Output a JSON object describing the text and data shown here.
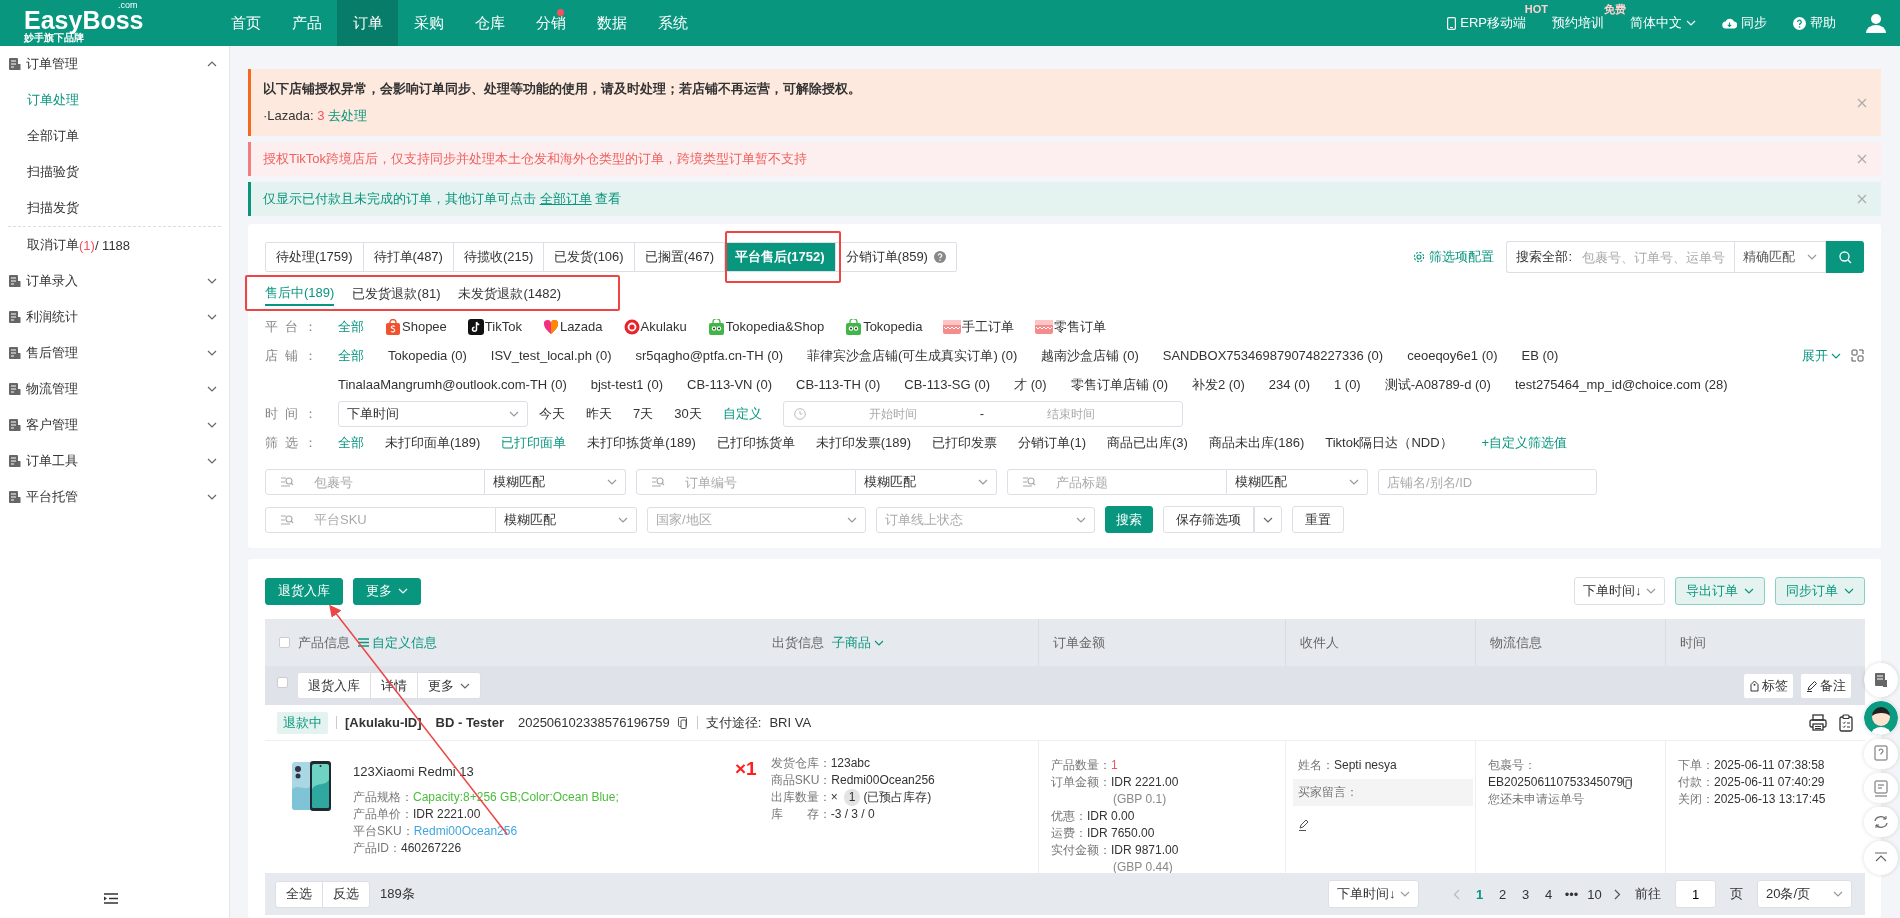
{
  "top_nav": {
    "logo": "EasyBoss",
    "logo_suffix": ".com",
    "tagline": "妙手旗下品牌",
    "items": [
      {
        "label": "首页",
        "selected": false,
        "dot": false
      },
      {
        "label": "产品",
        "selected": false,
        "dot": false
      },
      {
        "label": "订单",
        "selected": true,
        "dot": false
      },
      {
        "label": "采购",
        "selected": false,
        "dot": false
      },
      {
        "label": "仓库",
        "selected": false,
        "dot": false
      },
      {
        "label": "分销",
        "selected": false,
        "dot": true
      },
      {
        "label": "数据",
        "selected": false,
        "dot": false
      },
      {
        "label": "系统",
        "selected": false,
        "dot": false
      }
    ],
    "right": [
      {
        "kind": "mobile",
        "label": "ERP移动端",
        "badge": "HOT"
      },
      {
        "kind": "plain",
        "label": "预约培训",
        "badge": "免费"
      },
      {
        "kind": "language",
        "label": "简体中文"
      },
      {
        "kind": "sync",
        "label": "同步"
      },
      {
        "kind": "help",
        "label": "帮助"
      }
    ]
  },
  "sidebar": {
    "groups": [
      {
        "label": "订单管理",
        "expanded": true,
        "items": [
          {
            "label": "订单处理",
            "selected": true
          },
          {
            "label": "全部订单",
            "selected": false
          },
          {
            "label": "扫描验货",
            "selected": false
          },
          {
            "label": "扫描发货",
            "selected": false
          },
          {
            "label": "取消订单",
            "selected": false,
            "count": "(1)",
            "total": "/ 1188"
          }
        ]
      },
      {
        "label": "订单录入",
        "expanded": false
      },
      {
        "label": "利润统计",
        "expanded": false
      },
      {
        "label": "售后管理",
        "expanded": false
      },
      {
        "label": "物流管理",
        "expanded": false
      },
      {
        "label": "客户管理",
        "expanded": false
      },
      {
        "label": "订单工具",
        "expanded": false
      },
      {
        "label": "平台托管",
        "expanded": false
      }
    ]
  },
  "alerts": [
    {
      "kind": "warning",
      "text": "以下店铺授权异常，会影响订单同步、处理等功能的使用，请及时处理；若店铺不再运营，可解除授权。",
      "detail": {
        "prefix": "·Lazada:",
        "count": "3",
        "link": "去处理"
      }
    },
    {
      "kind": "error",
      "text": "授权TikTok跨境店后，仅支持同步并处理本土仓发和海外仓类型的订单，跨境类型订单暂不支持"
    },
    {
      "kind": "info",
      "text": "仅显示已付款且未完成的订单，其他订单可点击",
      "link": "全部订单",
      "suffix": "查看"
    }
  ],
  "status_tabs": [
    {
      "label": "待处理(1759)",
      "selected": false,
      "outlined": false,
      "help": false
    },
    {
      "label": "待打单(487)",
      "selected": false,
      "outlined": false,
      "help": false
    },
    {
      "label": "待揽收(215)",
      "selected": false,
      "outlined": false,
      "help": false
    },
    {
      "label": "已发货(106)",
      "selected": false,
      "outlined": false,
      "help": false
    },
    {
      "label": "已搁置(467)",
      "selected": false,
      "outlined": false,
      "help": false
    },
    {
      "label": "平台售后(1752)",
      "selected": true,
      "outlined": true,
      "help": false
    },
    {
      "label": "分销订单(859)",
      "selected": false,
      "outlined": false,
      "help": true
    }
  ],
  "filter_config": "筛选项配置",
  "search": {
    "label": "搜索全部:",
    "placeholder": "包裹号、订单号、运单号",
    "match": "精确匹配"
  },
  "sub_tabs": {
    "outlined": true,
    "items": [
      {
        "label": "售后中(189)",
        "selected": true
      },
      {
        "label": "已发货退款(81)",
        "selected": false
      },
      {
        "label": "未发货退款(1482)",
        "selected": false
      }
    ]
  },
  "platform_filter": {
    "label": "平台：",
    "items": [
      {
        "kind": "all",
        "label": "全部",
        "selected": true
      },
      {
        "kind": "shopee",
        "label": "Shopee",
        "selected": false
      },
      {
        "kind": "tiktok",
        "label": "TikTok",
        "selected": false
      },
      {
        "kind": "lazada",
        "label": "Lazada",
        "selected": false
      },
      {
        "kind": "akulaku",
        "label": "Akulaku",
        "selected": false
      },
      {
        "kind": "tokopedia",
        "label": "Tokopedia&Shop",
        "selected": false
      },
      {
        "kind": "tokopedia",
        "label": "Tokopedia",
        "selected": false
      },
      {
        "kind": "manual",
        "label": "手工订单",
        "selected": false
      },
      {
        "kind": "manual",
        "label": "零售订单",
        "selected": false
      }
    ]
  },
  "shop_filter": {
    "label": "店铺：",
    "expand": "展开",
    "items": [
      {
        "label": "全部",
        "selected": true
      },
      {
        "label": "Tokopedia (0)",
        "selected": false
      },
      {
        "label": "ISV_test_local.ph (0)",
        "selected": false
      },
      {
        "label": "sr5qagho@ptfa.cn-TH (0)",
        "selected": false
      },
      {
        "label": "菲律宾沙盒店铺(可生成真实订单) (0)",
        "selected": false
      },
      {
        "label": "越南沙盒店铺 (0)",
        "selected": false
      },
      {
        "label": "SANDBOX7534698790748227336 (0)",
        "selected": false
      },
      {
        "label": "ceoeqoy6e1 (0)",
        "selected": false
      },
      {
        "label": "EB (0)",
        "selected": false
      },
      {
        "label": "TinalaaMangrumh@outlook.com-TH (0)",
        "selected": false
      },
      {
        "label": "bjst-test1 (0)",
        "selected": false
      },
      {
        "label": "CB-113-VN (0)",
        "selected": false
      },
      {
        "label": "CB-113-TH (0)",
        "selected": false
      },
      {
        "label": "CB-113-SG (0)",
        "selected": false
      },
      {
        "label": "才 (0)",
        "selected": false
      },
      {
        "label": "零售订单店铺 (0)",
        "selected": false
      },
      {
        "label": "补发2 (0)",
        "selected": false
      },
      {
        "label": "234 (0)",
        "selected": false
      },
      {
        "label": "1 (0)",
        "selected": false
      },
      {
        "label": "测试-A08789-d (0)",
        "selected": false
      },
      {
        "label": "test275464_mp_id@choice.com (28)",
        "selected": false
      }
    ]
  },
  "time_filter": {
    "label": "时间：",
    "field": "下单时间",
    "quick": [
      {
        "label": "今天",
        "selected": false
      },
      {
        "label": "昨天",
        "selected": false
      },
      {
        "label": "7天",
        "selected": false
      },
      {
        "label": "30天",
        "selected": false
      },
      {
        "label": "自定义",
        "selected": true
      }
    ],
    "start_placeholder": "开始时间",
    "separator": "-",
    "end_placeholder": "结束时间"
  },
  "status_filter": {
    "label": "筛选：",
    "add": "+自定义筛选值",
    "items": [
      {
        "label": "全部",
        "selected": true
      },
      {
        "label": "未打印面单(189)",
        "selected": false
      },
      {
        "label": "已打印面单",
        "selected": true
      },
      {
        "label": "未打印拣货单(189)",
        "selected": false
      },
      {
        "label": "已打印拣货单",
        "selected": false
      },
      {
        "label": "未打印发票(189)",
        "selected": false
      },
      {
        "label": "已打印发票",
        "selected": false
      },
      {
        "label": "分销订单(1)",
        "selected": false
      },
      {
        "label": "商品已出库(3)",
        "selected": false
      },
      {
        "label": "商品未出库(186)",
        "selected": false
      },
      {
        "label": "Tiktok隔日达（NDD）",
        "selected": false
      }
    ]
  },
  "search_rows": [
    [
      {
        "kind": "search",
        "placeholder": "包裹号",
        "match": "模糊匹配"
      },
      {
        "kind": "search",
        "placeholder": "订单编号",
        "match": "模糊匹配"
      },
      {
        "kind": "search",
        "placeholder": "产品标题",
        "match": "模糊匹配"
      },
      {
        "kind": "text",
        "placeholder": "店铺名/别名/ID"
      }
    ],
    [
      {
        "kind": "search",
        "placeholder": "平台SKU",
        "match": "模糊匹配"
      },
      {
        "kind": "select",
        "placeholder": "国家/地区"
      },
      {
        "kind": "select",
        "placeholder": "订单线上状态"
      },
      {
        "kind": "primary",
        "label": "搜索"
      },
      {
        "kind": "split",
        "label": "保存筛选项"
      },
      {
        "kind": "plain",
        "label": "重置"
      }
    ]
  ],
  "toolbar": {
    "left": [
      {
        "kind": "primary",
        "label": "退货入库",
        "pointed": true
      },
      {
        "kind": "primary-dropdown",
        "label": "更多",
        "pointed": false
      }
    ],
    "right": [
      {
        "kind": "select",
        "label": "下单时间↓"
      },
      {
        "kind": "light-dropdown",
        "label": "导出订单"
      },
      {
        "kind": "light-dropdown",
        "label": "同步订单"
      }
    ]
  },
  "table": {
    "select_all_checked": false,
    "columns": [
      {
        "label": "产品信息",
        "extra": "自定义信息"
      },
      {
        "label": "出货信息",
        "extra": "子商品"
      },
      {
        "label": "订单金额"
      },
      {
        "label": "收件人"
      },
      {
        "label": "物流信息"
      },
      {
        "label": "时间"
      }
    ],
    "bulk_actions": [
      "退货入库",
      "详情",
      "更多"
    ],
    "order_actions": [
      "标签",
      "备注"
    ],
    "orders": [
      {
        "checked": false,
        "status": "退款中",
        "platform": "[Akulaku-ID]",
        "buyer": "BD - Tester",
        "order_no": "202506102338576196759",
        "payment_label": "支付途径:",
        "payment": "BRI VA",
        "product": {
          "kind": "picture",
          "name": "123Xiaomi Redmi 13",
          "quantity": "×1",
          "fields": [
            {
              "kind": "spec",
              "label": "产品规格：",
              "value": "Capacity:8+256 GB;Color:Ocean Blue;"
            },
            {
              "kind": "plain",
              "label": "产品单价：",
              "value": "IDR 2221.00"
            },
            {
              "kind": "link",
              "label": "平台SKU：",
              "value": "Redmi00Ocean256"
            },
            {
              "kind": "plain",
              "label": "产品ID：",
              "value": "460267226"
            }
          ]
        },
        "shipping": [
          {
            "label": "发货仓库：",
            "value": "123abc"
          },
          {
            "label": "商品SKU：",
            "value": "Redmi00Ocean256"
          },
          {
            "label": "出库数量：",
            "value": "×",
            "badge": "1",
            "note": "(已预占库存)"
          },
          {
            "label": "库　　存：",
            "value": "-3 / 3 / 0"
          }
        ],
        "amounts": [
          {
            "kind": "count",
            "label": "产品数量：",
            "value": "1"
          },
          {
            "kind": "plain",
            "label": "订单金额：",
            "value": "IDR 2221.00"
          },
          {
            "kind": "sub",
            "value": "(GBP 0.1)"
          },
          {
            "kind": "plain",
            "label": "优惠：",
            "value": "IDR 0.00"
          },
          {
            "kind": "plain",
            "label": "运费：",
            "value": "IDR 7650.00"
          },
          {
            "kind": "plain",
            "label": "实付金额：",
            "value": "IDR 9871.00"
          },
          {
            "kind": "sub",
            "value": "(GBP 0.44)"
          }
        ],
        "recipient": {
          "name_label": "姓名：",
          "name": "Septi nesya",
          "message_label": "买家留言："
        },
        "logistics": {
          "label": "包裹号：",
          "package_no": "EB202506110753345079",
          "note": "您还未申请运单号"
        },
        "times": [
          {
            "label": "下单：",
            "value": "2025-06-11 07:38:58"
          },
          {
            "label": "付款：",
            "value": "2025-06-11 07:40:29"
          },
          {
            "label": "关闭：",
            "value": "2025-06-13 13:17:45"
          }
        ]
      }
    ]
  },
  "footer": {
    "buttons": [
      "全选",
      "反选"
    ],
    "count": "189条",
    "sort": "下单时间↓",
    "pages": [
      {
        "label": "1",
        "selected": true
      },
      {
        "label": "2",
        "selected": false
      },
      {
        "label": "3",
        "selected": false
      },
      {
        "label": "4",
        "selected": false
      },
      {
        "label": "•••",
        "selected": false
      },
      {
        "label": "10",
        "selected": false
      }
    ],
    "goto": "前往",
    "page_input": "1",
    "page_unit": "页",
    "page_size": "20条/页"
  }
}
